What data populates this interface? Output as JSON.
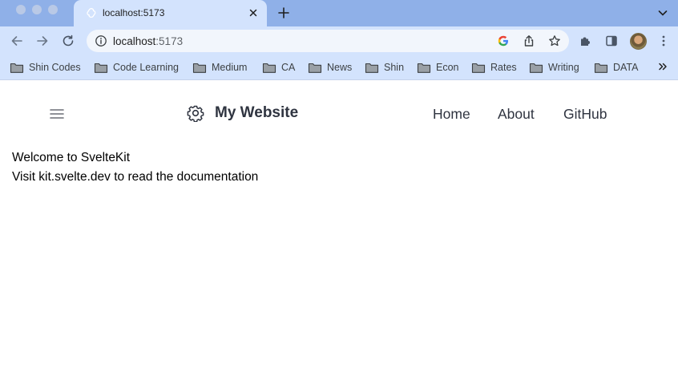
{
  "browser": {
    "tab": {
      "title": "localhost:5173"
    },
    "address": {
      "host": "localhost",
      "port": ":5173"
    },
    "bookmarks": [
      {
        "label": "Shin Codes"
      },
      {
        "label": "Code Learning"
      },
      {
        "label": "Medium"
      },
      {
        "label": "CA"
      },
      {
        "label": "News"
      },
      {
        "label": "Shin"
      },
      {
        "label": "Econ"
      },
      {
        "label": "Rates"
      },
      {
        "label": "Writing"
      },
      {
        "label": "DATA"
      }
    ],
    "icons": [
      "svelte-favicon",
      "close-icon",
      "plus-icon",
      "chevron-down-icon",
      "back-arrow-icon",
      "forward-arrow-icon",
      "reload-icon",
      "info-icon",
      "google-icon",
      "share-icon",
      "star-icon",
      "puzzle-icon",
      "sidebar-icon",
      "kebab-icon",
      "folder-icon",
      "double-chevron-icon"
    ]
  },
  "site": {
    "brand": "My Website",
    "nav": [
      {
        "label": "Home"
      },
      {
        "label": "About"
      },
      {
        "label": "GitHub"
      }
    ],
    "icons": [
      "hamburger-icon",
      "gear-icon"
    ]
  },
  "content": {
    "line1": "Welcome to SvelteKit",
    "line2": "Visit kit.svelte.dev to read the documentation"
  }
}
